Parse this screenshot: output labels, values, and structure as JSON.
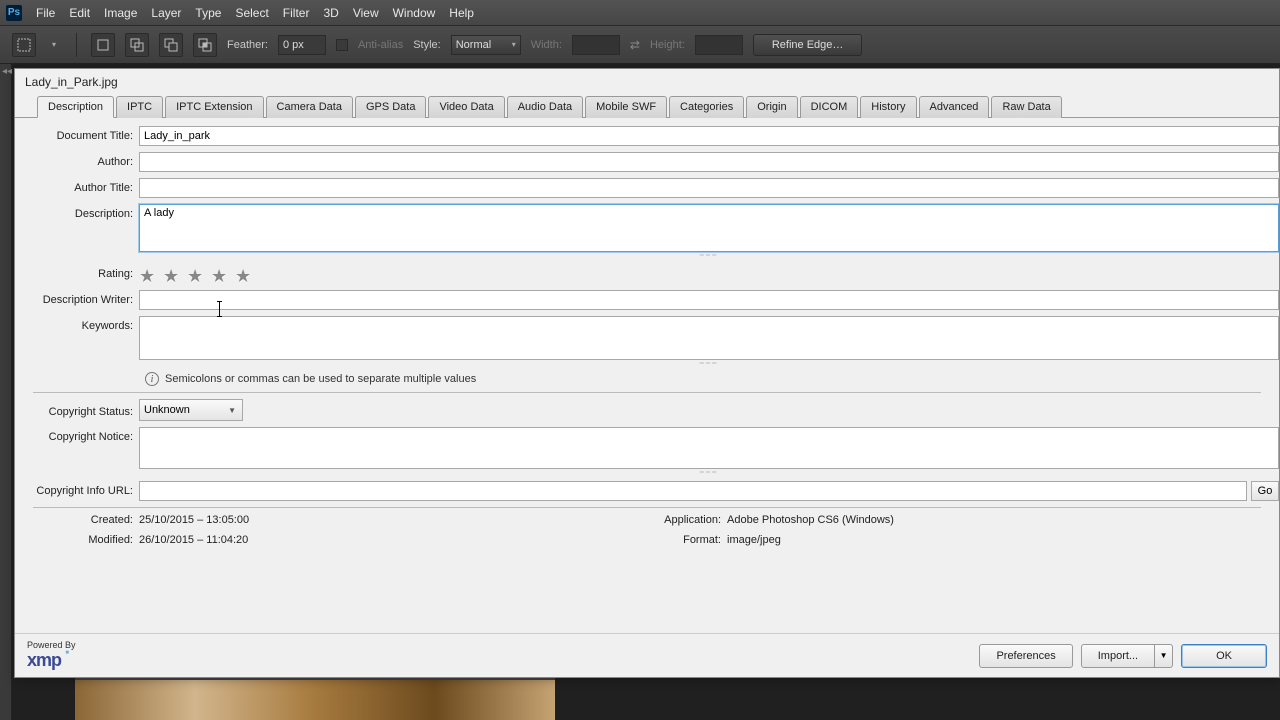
{
  "app": {
    "logo": "Ps"
  },
  "menus": [
    "File",
    "Edit",
    "Image",
    "Layer",
    "Type",
    "Select",
    "Filter",
    "3D",
    "View",
    "Window",
    "Help"
  ],
  "options": {
    "feather_label": "Feather:",
    "feather_value": "0 px",
    "anti_alias": "Anti-alias",
    "style_label": "Style:",
    "style_value": "Normal",
    "width_label": "Width:",
    "height_label": "Height:",
    "refine": "Refine Edge…"
  },
  "dialog": {
    "title": "Lady_in_Park.jpg",
    "tabs": [
      "Description",
      "IPTC",
      "IPTC Extension",
      "Camera Data",
      "GPS Data",
      "Video Data",
      "Audio Data",
      "Mobile SWF",
      "Categories",
      "Origin",
      "DICOM",
      "History",
      "Advanced",
      "Raw Data"
    ],
    "fields": {
      "document_title_label": "Document Title:",
      "document_title": "Lady_in_park",
      "author_label": "Author:",
      "author": "",
      "author_title_label": "Author Title:",
      "author_title": "",
      "description_label": "Description:",
      "description": "A lady",
      "rating_label": "Rating:",
      "description_writer_label": "Description Writer:",
      "description_writer": "",
      "keywords_label": "Keywords:",
      "keywords": "",
      "keywords_hint": "Semicolons or commas can be used to separate multiple values",
      "copyright_status_label": "Copyright Status:",
      "copyright_status": "Unknown",
      "copyright_notice_label": "Copyright Notice:",
      "copyright_notice": "",
      "copyright_info_url_label": "Copyright Info URL:",
      "copyright_info_url": "",
      "go": "Go "
    },
    "meta": {
      "created_label": "Created:",
      "created": "25/10/2015 – 13:05:00",
      "modified_label": "Modified:",
      "modified": "26/10/2015 – 11:04:20",
      "application_label": "Application:",
      "application": "Adobe Photoshop CS6 (Windows)",
      "format_label": "Format:",
      "format": "image/jpeg"
    },
    "footer": {
      "powered_by": "Powered By",
      "xmp": "xmp",
      "preferences": "Preferences",
      "import": "Import...",
      "ok": "OK"
    }
  }
}
